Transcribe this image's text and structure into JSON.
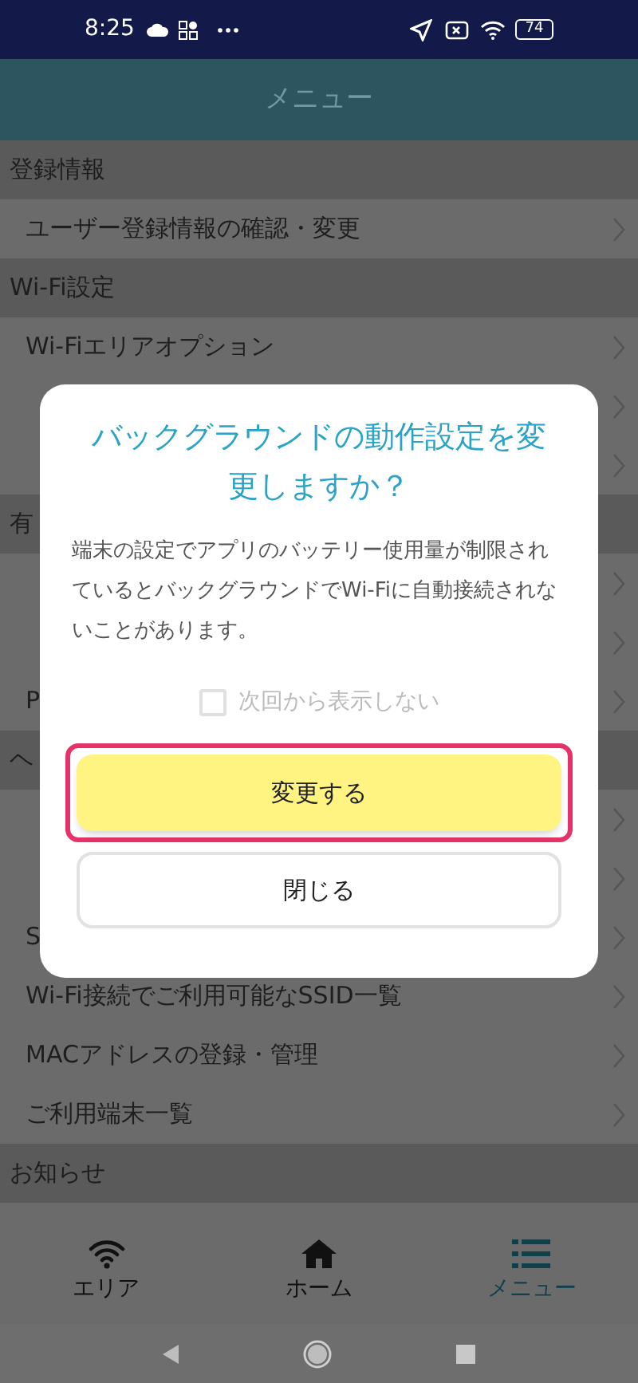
{
  "status_bar": {
    "time": "8:25",
    "battery": "74"
  },
  "header": {
    "title": "メニュー"
  },
  "menu": [
    {
      "kind": "section",
      "label": "登録情報"
    },
    {
      "kind": "item",
      "label": "ユーザー登録情報の確認・変更"
    },
    {
      "kind": "section",
      "label": "Wi-Fi設定"
    },
    {
      "kind": "item",
      "label": "Wi-Fiエリアオプション"
    },
    {
      "kind": "item"
    },
    {
      "kind": "item"
    },
    {
      "kind": "section",
      "label": "有"
    },
    {
      "kind": "item"
    },
    {
      "kind": "item"
    },
    {
      "kind": "item",
      "label": "P"
    },
    {
      "kind": "section",
      "label": "ヘ"
    },
    {
      "kind": "item"
    },
    {
      "kind": "item"
    },
    {
      "kind": "item",
      "label": "S"
    },
    {
      "kind": "item",
      "label": "Wi-Fi接続でご利用可能なSSID一覧"
    },
    {
      "kind": "item",
      "label": "MACアドレスの登録・管理"
    },
    {
      "kind": "item",
      "label": "ご利用端末一覧"
    },
    {
      "kind": "section",
      "label": "お知らせ"
    }
  ],
  "dialog": {
    "title": "バックグラウンドの動作設定を変更しますか？",
    "message": "端末の設定でアプリのバッテリー使用量が制限されているとバックグラウンドでWi-Fiに自動接続されないことがあります。",
    "checkbox": {
      "label": "次回から表示しない",
      "checked": false
    },
    "buttons": [
      {
        "label": "変更する",
        "kind": "primary",
        "highlighted": true
      },
      {
        "label": "閉じる",
        "kind": "secondary",
        "highlighted": false
      }
    ]
  },
  "bottom_nav": [
    {
      "label": "エリア",
      "kind": "wifi",
      "selected": false
    },
    {
      "label": "ホーム",
      "kind": "home",
      "selected": false
    },
    {
      "label": "メニュー",
      "kind": "list",
      "selected": true
    }
  ]
}
